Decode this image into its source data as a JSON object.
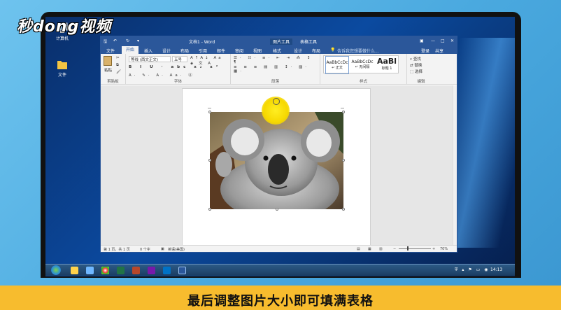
{
  "brand": {
    "logo_text": "秒dong视频"
  },
  "desktop": {
    "icons": [
      {
        "label": "计算机"
      },
      {
        "label": "文件"
      }
    ]
  },
  "word": {
    "title": "文档1 - Word",
    "context_tab_group": "图片工具",
    "context_tab_group2": "表格工具",
    "window_controls": [
      "▣",
      "—",
      "□",
      "✕"
    ],
    "tabs": [
      "文件",
      "开始",
      "插入",
      "设计",
      "布局",
      "引用",
      "邮件",
      "审阅",
      "视图",
      "格式",
      "设计",
      "布局"
    ],
    "tell_me": "告诉我您想要做什么...",
    "login": "登录",
    "share": "共享",
    "clipboard": {
      "paste": "粘贴",
      "label": "剪贴板"
    },
    "font": {
      "name": "等线 (西文正文)",
      "size": "五号",
      "label": "字体"
    },
    "paragraph": {
      "label": "段落"
    },
    "styles": {
      "items": [
        "AaBbCcDc",
        "AaBbCcDc",
        "AaBl"
      ],
      "names": [
        "↵ 正文",
        "↵ 无间隔",
        "标题 1"
      ],
      "label": "样式"
    },
    "editing": {
      "find": "查找",
      "replace": "替换",
      "select": "选择",
      "label": "编辑"
    },
    "status": {
      "page": "第 1 页，共 1 页",
      "words": "0 个字",
      "lang": "英语(美国)",
      "zoom": "70%"
    }
  },
  "taskbar": {
    "time": "14:13"
  },
  "caption": "最后调整图片大小即可填满表格",
  "colors": {
    "word_blue": "#2b579a",
    "caption_bg": "#f7bc2e",
    "highlight": "#f6d800"
  }
}
